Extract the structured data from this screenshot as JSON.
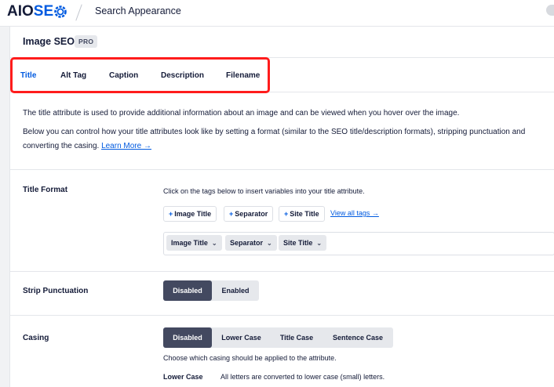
{
  "topbar": {
    "logo_aio": "AIO",
    "logo_seo": "SE",
    "page_title": "Search Appearance"
  },
  "card": {
    "title": "Image SEO",
    "badge": "PRO"
  },
  "tabs": [
    {
      "label": "Title",
      "active": true
    },
    {
      "label": "Alt Tag",
      "active": false
    },
    {
      "label": "Caption",
      "active": false
    },
    {
      "label": "Description",
      "active": false
    },
    {
      "label": "Filename",
      "active": false
    }
  ],
  "description": {
    "line1": "The title attribute is used to provide additional information about an image and can be viewed when you hover over the image.",
    "line2": "Below you can control how your title attributes look like by setting a format (similar to the SEO title/description formats), stripping punctuation and",
    "line3": "converting the casing.",
    "learn_more": "Learn More →"
  },
  "title_format": {
    "label": "Title Format",
    "hint": "Click on the tags below to insert variables into your title attribute.",
    "tag_buttons": [
      "Image Title",
      "Separator",
      "Site Title"
    ],
    "plus": "+",
    "view_all": "View all tags →",
    "chips": [
      "Image Title",
      "Separator",
      "Site Title"
    ],
    "caret": "⌄"
  },
  "strip_punctuation": {
    "label": "Strip Punctuation",
    "options": [
      "Disabled",
      "Enabled"
    ],
    "selected": "Disabled"
  },
  "casing": {
    "label": "Casing",
    "options": [
      "Disabled",
      "Lower Case",
      "Title Case",
      "Sentence Case"
    ],
    "selected": "Disabled",
    "hint": "Choose which casing should be applied to the attribute.",
    "detail_label": "Lower Case",
    "detail_text": "All letters are converted to lower case (small) letters."
  },
  "colors": {
    "brand_blue": "#005ae0",
    "dark_navy": "#141b38",
    "toggle_active": "#434960",
    "highlight_red": "#ff1c1c"
  }
}
